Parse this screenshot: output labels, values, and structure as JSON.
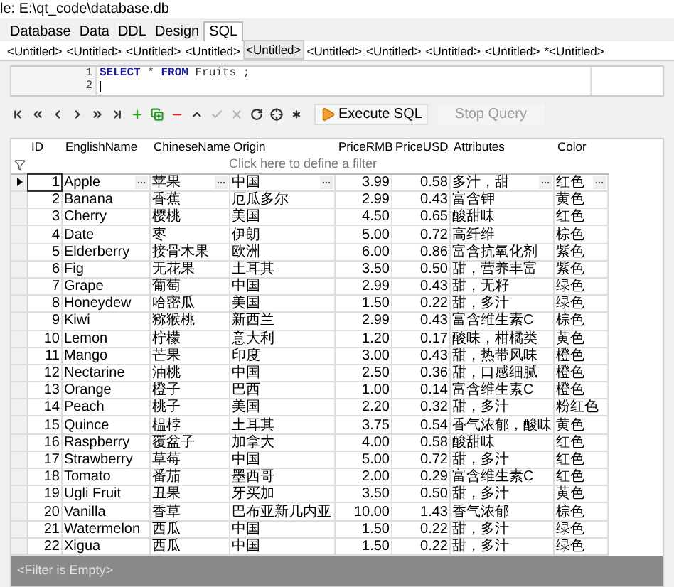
{
  "title_line": "le: E:\\qt_code\\database.db",
  "main_tabs": [
    {
      "label": "Database",
      "selected": false
    },
    {
      "label": "Data",
      "selected": false
    },
    {
      "label": "DDL",
      "selected": false
    },
    {
      "label": "Design",
      "selected": false
    },
    {
      "label": "SQL",
      "selected": true
    }
  ],
  "query_tabs": [
    {
      "label": "<Untitled>",
      "selected": false
    },
    {
      "label": "<Untitled>",
      "selected": false
    },
    {
      "label": "<Untitled>",
      "selected": false
    },
    {
      "label": "<Untitled>",
      "selected": false
    },
    {
      "label": "<Untitled>",
      "selected": true
    },
    {
      "label": "<Untitled>",
      "selected": false
    },
    {
      "label": "<Untitled>",
      "selected": false
    },
    {
      "label": "<Untitled>",
      "selected": false
    },
    {
      "label": "<Untitled>",
      "selected": false
    },
    {
      "label": "*<Untitled>",
      "selected": false
    }
  ],
  "editor": {
    "lines": [
      {
        "number": "1",
        "tokens": [
          {
            "kind": "keyword",
            "text": "SELECT"
          },
          {
            "kind": "plain",
            "text": " * "
          },
          {
            "kind": "keyword",
            "text": "FROM"
          },
          {
            "kind": "plain",
            "text": " Fruits ;"
          }
        ]
      },
      {
        "number": "2"
      }
    ]
  },
  "toolbar": {
    "nav_buttons": [
      {
        "kind": "first",
        "disabled": false
      },
      {
        "kind": "prev_page",
        "disabled": false
      },
      {
        "kind": "prev",
        "disabled": false
      },
      {
        "kind": "next",
        "disabled": false
      },
      {
        "kind": "next_page",
        "disabled": false
      },
      {
        "kind": "last",
        "disabled": false
      },
      {
        "kind": "insert",
        "disabled": false
      },
      {
        "kind": "insert_many",
        "disabled": false
      },
      {
        "kind": "delete",
        "disabled": false
      },
      {
        "kind": "edit",
        "disabled": false
      },
      {
        "kind": "post",
        "disabled": true
      },
      {
        "kind": "cancel",
        "disabled": true
      },
      {
        "kind": "refresh",
        "disabled": false
      },
      {
        "kind": "bookmark",
        "disabled": false
      },
      {
        "kind": "filter",
        "disabled": false
      }
    ],
    "execute": {
      "label": "Execute SQL",
      "disabled": false
    },
    "stop": {
      "label": "Stop Query",
      "disabled": true
    }
  },
  "grid": {
    "columns": [
      "ID",
      "EnglishName",
      "ChineseName",
      "Origin",
      "PriceRMB",
      "PriceUSD",
      "Attributes",
      "Color"
    ],
    "filter_hint": "Click here to define a filter",
    "rows": [
      {
        "selected": true,
        "cells": [
          "1",
          "Apple",
          "苹果",
          "中国",
          "3.99",
          "0.58",
          "多汁，甜",
          "红色"
        ]
      },
      {
        "selected": false,
        "cells": [
          "2",
          "Banana",
          "香蕉",
          "厄瓜多尔",
          "2.99",
          "0.43",
          "富含钾",
          "黄色"
        ]
      },
      {
        "selected": false,
        "cells": [
          "3",
          "Cherry",
          "樱桃",
          "美国",
          "4.50",
          "0.65",
          "酸甜味",
          "红色"
        ]
      },
      {
        "selected": false,
        "cells": [
          "4",
          "Date",
          "枣",
          "伊朗",
          "5.00",
          "0.72",
          "高纤维",
          "棕色"
        ]
      },
      {
        "selected": false,
        "cells": [
          "5",
          "Elderberry",
          "接骨木果",
          "欧洲",
          "6.00",
          "0.86",
          "富含抗氧化剂",
          "紫色"
        ]
      },
      {
        "selected": false,
        "cells": [
          "6",
          "Fig",
          "无花果",
          "土耳其",
          "3.50",
          "0.50",
          "甜，营养丰富",
          "紫色"
        ]
      },
      {
        "selected": false,
        "cells": [
          "7",
          "Grape",
          "葡萄",
          "中国",
          "2.99",
          "0.43",
          "甜，无籽",
          "绿色"
        ]
      },
      {
        "selected": false,
        "cells": [
          "8",
          "Honeydew",
          "哈密瓜",
          "美国",
          "1.50",
          "0.22",
          "甜，多汁",
          "绿色"
        ]
      },
      {
        "selected": false,
        "cells": [
          "9",
          "Kiwi",
          "猕猴桃",
          "新西兰",
          "2.99",
          "0.43",
          "富含维生素C",
          "棕色"
        ]
      },
      {
        "selected": false,
        "cells": [
          "10",
          "Lemon",
          "柠檬",
          "意大利",
          "1.20",
          "0.17",
          "酸味，柑橘类",
          "黄色"
        ]
      },
      {
        "selected": false,
        "cells": [
          "11",
          "Mango",
          "芒果",
          "印度",
          "3.00",
          "0.43",
          "甜，热带风味",
          "橙色"
        ]
      },
      {
        "selected": false,
        "cells": [
          "12",
          "Nectarine",
          "油桃",
          "中国",
          "2.50",
          "0.36",
          "甜，口感细腻",
          "橙色"
        ]
      },
      {
        "selected": false,
        "cells": [
          "13",
          "Orange",
          "橙子",
          "巴西",
          "1.00",
          "0.14",
          "富含维生素C",
          "橙色"
        ]
      },
      {
        "selected": false,
        "cells": [
          "14",
          "Peach",
          "桃子",
          "美国",
          "2.20",
          "0.32",
          "甜，多汁",
          "粉红色"
        ]
      },
      {
        "selected": false,
        "cells": [
          "15",
          "Quince",
          "榅桲",
          "土耳其",
          "3.75",
          "0.54",
          "香气浓郁，酸味",
          "黄色"
        ]
      },
      {
        "selected": false,
        "cells": [
          "16",
          "Raspberry",
          "覆盆子",
          "加拿大",
          "4.00",
          "0.58",
          "酸甜味",
          "红色"
        ]
      },
      {
        "selected": false,
        "cells": [
          "17",
          "Strawberry",
          "草莓",
          "中国",
          "5.00",
          "0.72",
          "甜，多汁",
          "红色"
        ]
      },
      {
        "selected": false,
        "cells": [
          "18",
          "Tomato",
          "番茄",
          "墨西哥",
          "2.00",
          "0.29",
          "富含维生素C",
          "红色"
        ]
      },
      {
        "selected": false,
        "cells": [
          "19",
          "Ugli Fruit",
          "丑果",
          "牙买加",
          "3.50",
          "0.50",
          "甜，多汁",
          "黄色"
        ]
      },
      {
        "selected": false,
        "cells": [
          "20",
          "Vanilla",
          "香草",
          "巴布亚新几内亚",
          "10.00",
          "1.43",
          "香气浓郁",
          "棕色"
        ]
      },
      {
        "selected": false,
        "cells": [
          "21",
          "Watermelon",
          "西瓜",
          "中国",
          "1.50",
          "0.22",
          "甜，多汁",
          "绿色"
        ]
      },
      {
        "selected": false,
        "cells": [
          "22",
          "Xigua",
          "西瓜",
          "中国",
          "1.50",
          "0.22",
          "甜，多汁",
          "绿色"
        ]
      }
    ]
  },
  "filter_bar": {
    "text": "<Filter is Empty>"
  }
}
